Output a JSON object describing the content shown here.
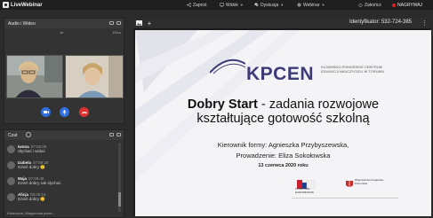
{
  "app": {
    "name": "LiveWebinar"
  },
  "topbar": {
    "invite": "Zaproś",
    "view": "Widok",
    "discussion": "Dyskusja",
    "webinar": "Webinar",
    "end": "Zakończ",
    "record": "NAGRYWAJ"
  },
  "av_panel": {
    "title": "Audio i Wideo",
    "label_left": "Ja",
    "label_right": "Eliza"
  },
  "chat": {
    "title": "Czat",
    "messages": [
      {
        "name": "Iwona",
        "time": "07:59:06",
        "text": "Słychać i widać"
      },
      {
        "name": "Izabela",
        "time": "07:59:29",
        "text": "Dzień dobry 🙂"
      },
      {
        "name": "Maja",
        "time": "07:59:46",
        "text": "Dzień dobry, tak słychać."
      },
      {
        "name": "Alicja",
        "time": "08:00:16",
        "text": "Dzień dobry 🙂"
      }
    ],
    "footer": "Katarzyna, Małgorzata pisze..."
  },
  "presentation": {
    "identifier": "Identyfikator: 532-724-385",
    "tab_add": "+"
  },
  "slide": {
    "logo_text": "KPCEN",
    "logo_sub": "KUJAWSKO-POMORSKIE CENTRUM EDUKACJI NAUCZYCIELI W TORUNIU",
    "title_bold": "Dobry Start",
    "title_rest": " - zadania rozwojowe",
    "title_line2": "kształtujące gotowość szkolną",
    "leader": "Kierownik formy: Agnieszka Przybyszewska,",
    "host": "Prowadzenie: Eliza Sokołowska",
    "date": "13 czerwca 2020 roku",
    "sponsor1": "FUNDUSZE EUROPEJSKIE",
    "sponsor2": "Województwo Kujawsko-Pomorskie"
  },
  "colors": {
    "brand": "#3d3b77",
    "record": "#e02020",
    "mic": "#2f6fe0",
    "hangup": "#e03030"
  }
}
